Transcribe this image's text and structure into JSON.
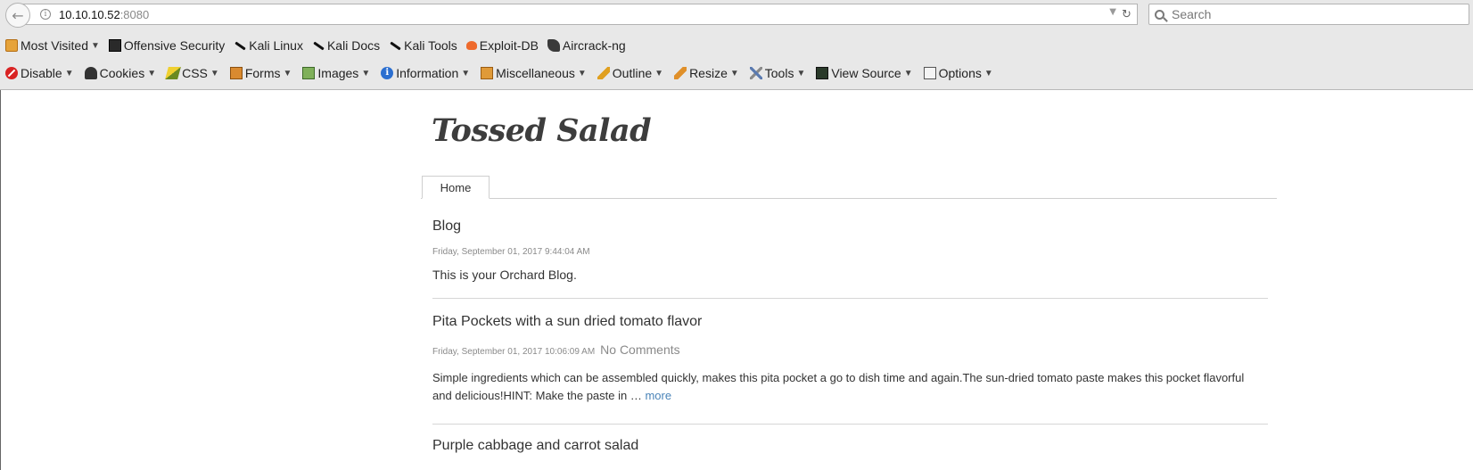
{
  "browser": {
    "url_host": "10.10.10.52",
    "url_port": ":8080",
    "search_placeholder": "Search",
    "bookmarks": [
      {
        "label": "Most Visited",
        "icon": "folder-icon",
        "dropdown": true
      },
      {
        "label": "Offensive Security",
        "icon": "offsec-icon"
      },
      {
        "label": "Kali Linux",
        "icon": "kali-icon"
      },
      {
        "label": "Kali Docs",
        "icon": "kali-icon"
      },
      {
        "label": "Kali Tools",
        "icon": "kali-icon"
      },
      {
        "label": "Exploit-DB",
        "icon": "exploitdb-icon"
      },
      {
        "label": "Aircrack-ng",
        "icon": "aircrack-icon"
      }
    ],
    "devtools": [
      {
        "label": "Disable",
        "icon": "disable-icon"
      },
      {
        "label": "Cookies",
        "icon": "cookies-icon"
      },
      {
        "label": "CSS",
        "icon": "css-icon"
      },
      {
        "label": "Forms",
        "icon": "forms-icon"
      },
      {
        "label": "Images",
        "icon": "images-icon"
      },
      {
        "label": "Information",
        "icon": "information-icon"
      },
      {
        "label": "Miscellaneous",
        "icon": "miscellaneous-icon"
      },
      {
        "label": "Outline",
        "icon": "outline-icon"
      },
      {
        "label": "Resize",
        "icon": "resize-icon"
      },
      {
        "label": "Tools",
        "icon": "tools-icon"
      },
      {
        "label": "View Source",
        "icon": "view-source-icon"
      },
      {
        "label": "Options",
        "icon": "options-icon"
      }
    ]
  },
  "site": {
    "title": "Tossed Salad",
    "nav": {
      "home": "Home"
    }
  },
  "posts": [
    {
      "title": "Blog",
      "date": "Friday, September 01, 2017 9:44:04 AM",
      "body": "This is your Orchard Blog."
    },
    {
      "title": "Pita Pockets with a sun dried tomato flavor",
      "date": "Friday, September 01, 2017 10:06:09 AM",
      "comments": "No Comments",
      "body_line1": "Simple ingredients which can be assembled quickly, makes this pita pocket a go to dish time and again.The sun-dried tomato paste makes this pocket flavorful",
      "body_line2": "and delicious!HINT:  Make the paste in …",
      "more": "more"
    },
    {
      "title": "Purple cabbage and carrot salad"
    }
  ]
}
